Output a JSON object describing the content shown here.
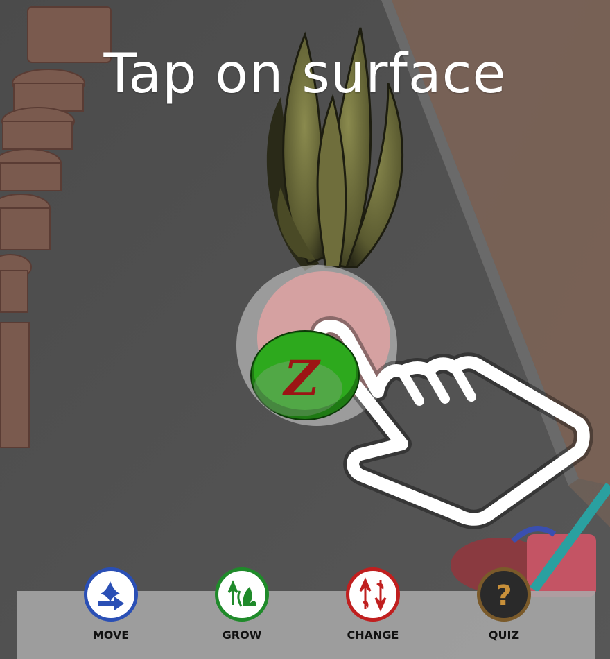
{
  "prompt": {
    "text": "Tap on surface"
  },
  "badge": {
    "text": "Z"
  },
  "toolbar": {
    "items": [
      {
        "key": "move",
        "label": "MOVE",
        "icon": "move-icon",
        "color": "#2a4fb5"
      },
      {
        "key": "grow",
        "label": "GROW",
        "icon": "grow-icon",
        "color": "#1f8a2a"
      },
      {
        "key": "change",
        "label": "CHANGE",
        "icon": "change-icon",
        "color": "#c01f1f"
      },
      {
        "key": "quiz",
        "label": "QUIZ",
        "icon": "quiz-icon",
        "color": "#7a5a2a"
      }
    ]
  },
  "colors": {
    "placement_indicator": "#e8a3a3",
    "badge_green": "#2fae1f",
    "badge_red": "#c01f1f"
  }
}
